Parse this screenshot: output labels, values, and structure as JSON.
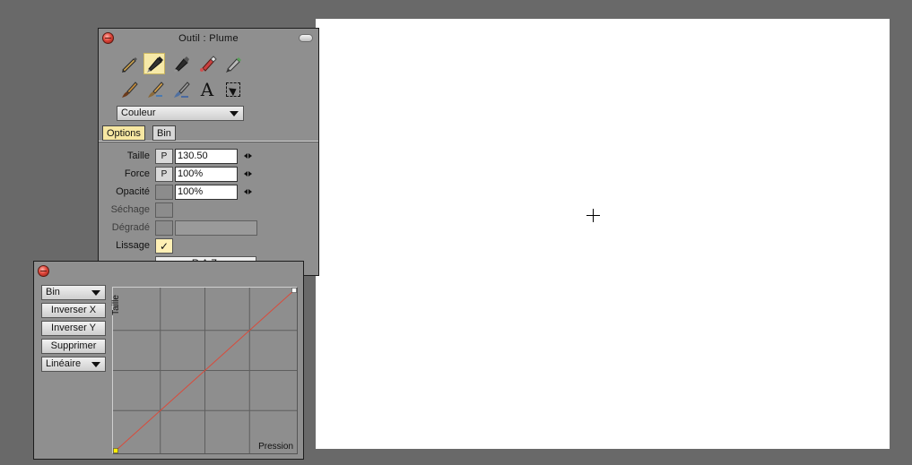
{
  "tool_panel": {
    "title": "Outil : Plume",
    "tools_row1": [
      "pencil-icon",
      "pen-icon",
      "marker-icon",
      "airbrush-icon",
      "eraser-pencil-icon"
    ],
    "tools_row2": [
      "brush-icon",
      "wet-brush-icon",
      "flat-brush-icon",
      "text-icon",
      "selection-icon"
    ],
    "text_tool_glyph": "A",
    "active_tool": "pen-icon",
    "mode_select": "Couleur",
    "tabs": [
      {
        "label": "Options",
        "active": true
      },
      {
        "label": "Bin",
        "active": false
      }
    ],
    "rows": {
      "size": {
        "label": "Taille",
        "p": "P",
        "value": "130.50"
      },
      "force": {
        "label": "Force",
        "p": "P",
        "value": "100%"
      },
      "opacity": {
        "label": "Opacité",
        "value": "100%"
      },
      "drying": {
        "label": "Séchage"
      },
      "gradient": {
        "label": "Dégradé"
      },
      "smoothing": {
        "label": "Lissage",
        "checked": true
      }
    },
    "reset_label": "R.A.Z."
  },
  "curve_panel": {
    "source_select": "Bin",
    "invert_x": "Inverser X",
    "invert_y": "Inverser Y",
    "delete": "Supprimer",
    "interpolation_select": "Linéaire",
    "y_axis_label": "Taille",
    "x_axis_label": "Pression",
    "curve": {
      "from": [
        0,
        0
      ],
      "to": [
        1,
        1
      ],
      "type": "linear"
    },
    "curve_color": "#d94b3b",
    "start_point_color": "#ffee00",
    "end_point_color": "#ffffff"
  },
  "colors": {
    "desktop": "#696969",
    "panel": "#8f8f8f",
    "canvas": "#ffffff",
    "active_highlight": "#f6e9a8"
  }
}
